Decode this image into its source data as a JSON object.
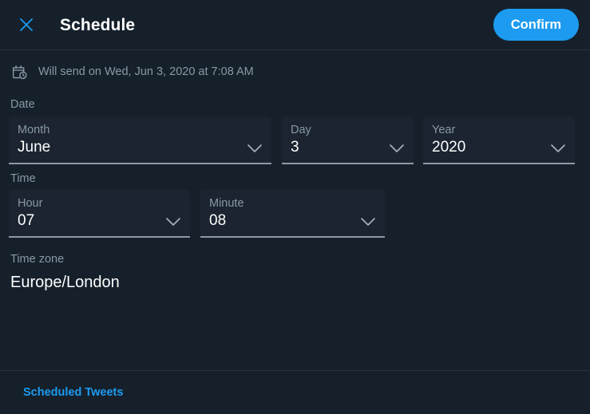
{
  "header": {
    "title": "Schedule",
    "close_icon": "close-x-icon",
    "confirm_label": "Confirm"
  },
  "summary": {
    "icon": "calendar-clock-icon",
    "text": "Will send on Wed, Jun 3, 2020 at 7:08 AM"
  },
  "date": {
    "section_label": "Date",
    "fields": [
      {
        "label": "Month",
        "value": "June"
      },
      {
        "label": "Day",
        "value": "3"
      },
      {
        "label": "Year",
        "value": "2020"
      }
    ]
  },
  "time": {
    "section_label": "Time",
    "fields": [
      {
        "label": "Hour",
        "value": "07"
      },
      {
        "label": "Minute",
        "value": "08"
      }
    ]
  },
  "timezone": {
    "label": "Time zone",
    "value": "Europe/London"
  },
  "footer": {
    "link_label": "Scheduled Tweets"
  },
  "colors": {
    "background": "#15202b",
    "field_background": "#1b2430",
    "accent": "#1d9bf0",
    "muted_text": "#8899a6",
    "divider": "#28353f",
    "field_underline": "#8c9aa6"
  }
}
